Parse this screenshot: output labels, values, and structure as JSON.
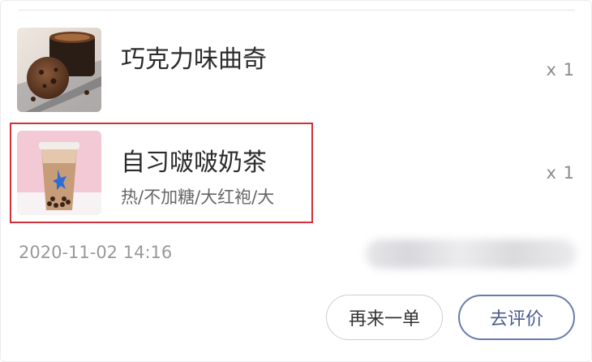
{
  "items": [
    {
      "name": "巧克力味曲奇",
      "spec": "",
      "qty": "x 1",
      "image": "cookie-coffee-photo"
    },
    {
      "name": "自习啵啵奶茶",
      "spec": "热/不加糖/大红袍/大",
      "qty": "x 1",
      "image": "bubble-milk-tea-photo"
    }
  ],
  "order": {
    "time": "2020-11-02 14:16"
  },
  "actions": {
    "reorder_label": "再来一单",
    "review_label": "去评价"
  },
  "colors": {
    "highlight": "#d32f3a",
    "review_border": "#6a7cad"
  }
}
